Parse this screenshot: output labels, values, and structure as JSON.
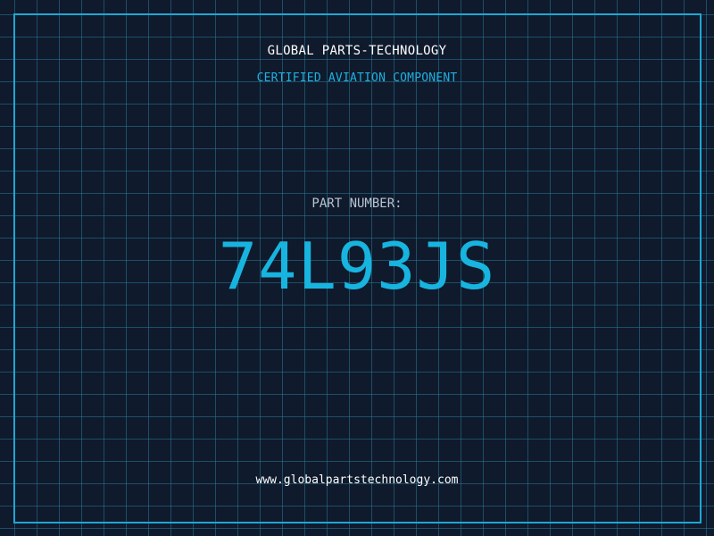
{
  "header": {
    "company": "GLOBAL PARTS-TECHNOLOGY",
    "subtitle": "CERTIFIED AVIATION COMPONENT"
  },
  "part": {
    "label": "PART NUMBER:",
    "number": "74L93JS"
  },
  "footer": {
    "url": "www.globalpartstechnology.com"
  },
  "colors": {
    "background": "#0f1a2c",
    "accent": "#18b4e0",
    "grid": "#28789a"
  }
}
